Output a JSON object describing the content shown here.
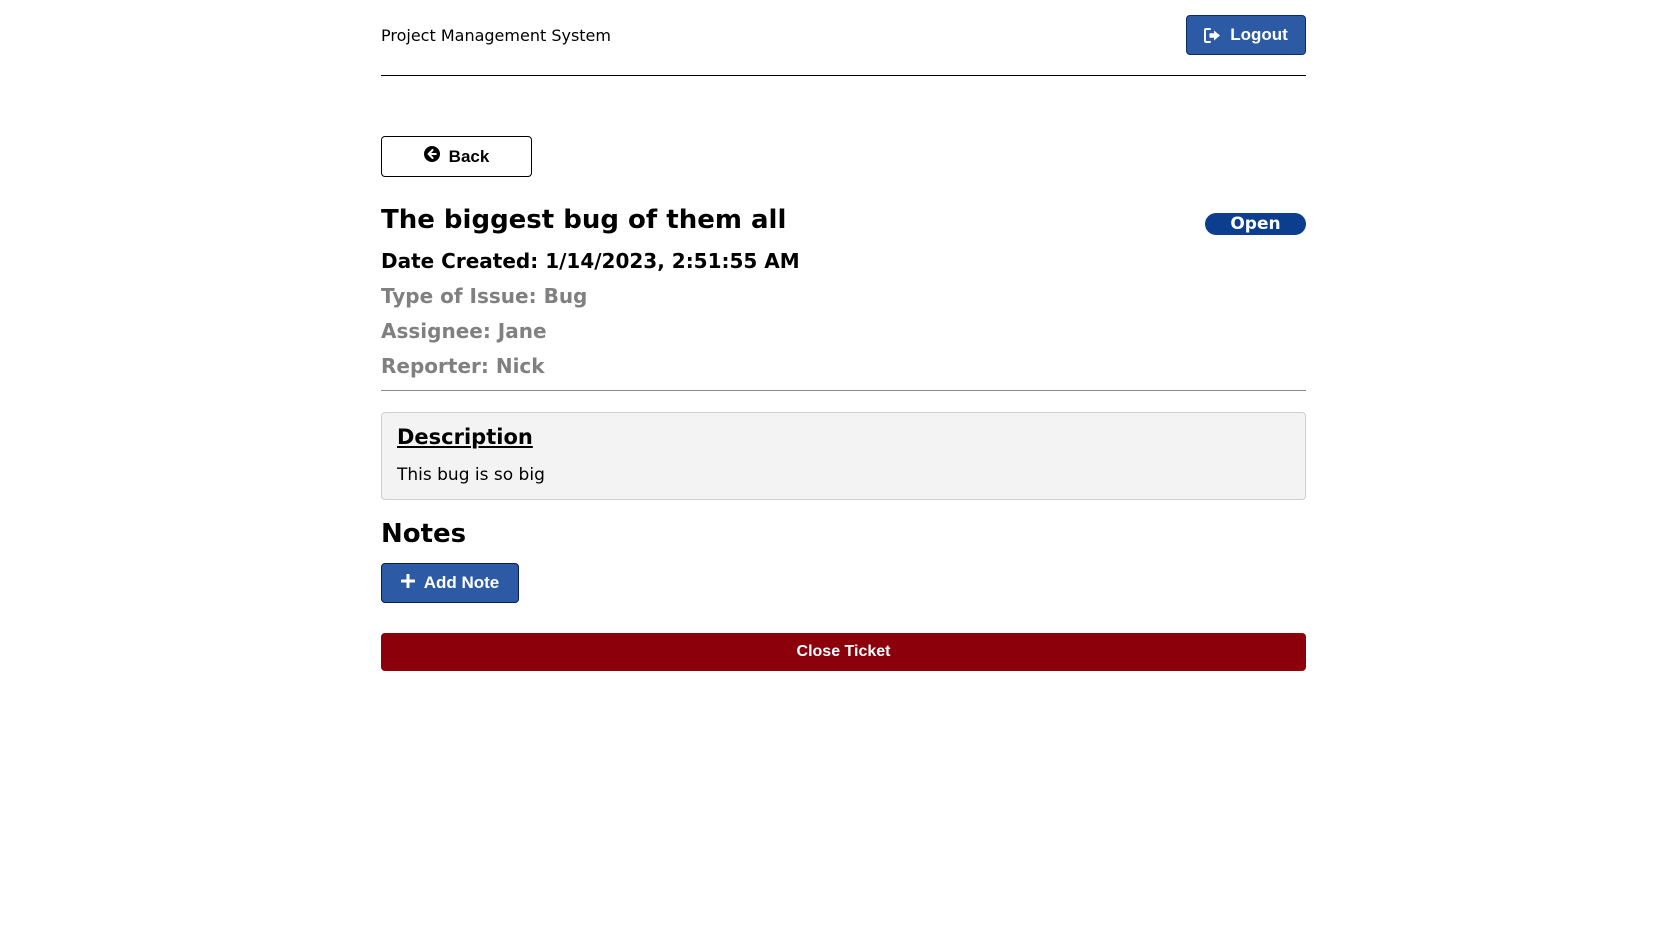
{
  "header": {
    "app_title": "Project Management System",
    "logout_label": "Logout",
    "logout_icon": "sign-out-icon"
  },
  "nav": {
    "back_label": "Back",
    "back_icon": "arrow-circle-left-icon"
  },
  "ticket": {
    "title": "The biggest bug of them all",
    "status": "Open",
    "date_created": "Date Created: 1/14/2023, 2:51:55 AM",
    "type_of_issue": "Type of Issue: Bug",
    "assignee": "Assignee: Jane",
    "reporter": "Reporter: Nick"
  },
  "description": {
    "heading": "Description",
    "text": "This bug is so big"
  },
  "notes": {
    "heading": "Notes",
    "add_note_label": "Add Note",
    "add_note_icon": "plus-icon"
  },
  "actions": {
    "close_ticket_label": "Close Ticket"
  },
  "colors": {
    "primary_button": "#2c5aa5",
    "status_badge": "#0b3e8f",
    "danger_button": "#8b000b",
    "muted_text": "#808080",
    "description_bg": "#f3f3f3"
  }
}
